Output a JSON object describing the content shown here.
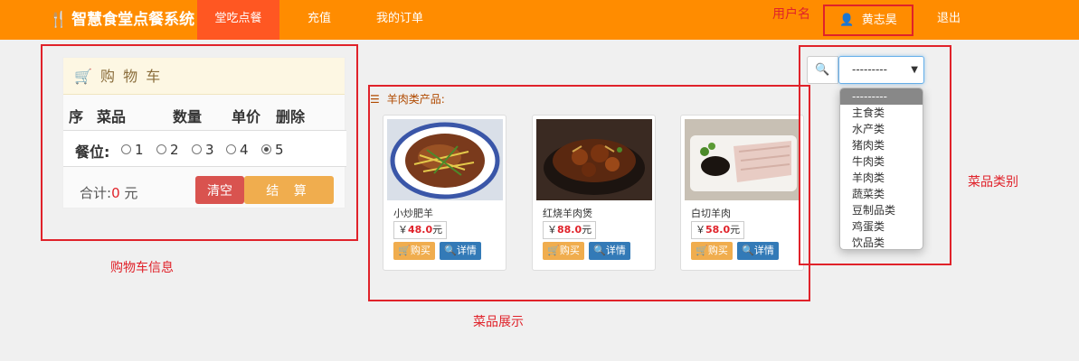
{
  "nav": {
    "brand": "智慧食堂点餐系统",
    "items": [
      "堂吃点餐",
      "充值",
      "我的订单"
    ],
    "user_name": "黄志昊",
    "logout": "退出"
  },
  "annotations": {
    "username": "用户名",
    "cart_info": "购物车信息",
    "dish_display": "菜品展示",
    "dish_category": "菜品类别"
  },
  "cart": {
    "title": "购 物 车",
    "columns": [
      "序",
      "菜品",
      "数量",
      "单价",
      "删除"
    ],
    "seat_label": "餐位:",
    "seats": [
      "1",
      "2",
      "3",
      "4",
      "5"
    ],
    "selected_seat": "5",
    "total_label": "合计:",
    "total_amount": "0",
    "total_unit": " 元",
    "clear": "清空",
    "checkout": "结 算"
  },
  "products": {
    "category_label": "羊肉类产品:",
    "items": [
      {
        "name": "小炒肥羊",
        "currency": "￥",
        "price": "48.0",
        "unit": "元",
        "buy": "购买",
        "detail": "详情"
      },
      {
        "name": "红烧羊肉煲",
        "currency": "￥",
        "price": "88.0",
        "unit": "元",
        "buy": "购买",
        "detail": "详情"
      },
      {
        "name": "白切羊肉",
        "currency": "￥",
        "price": "58.0",
        "unit": "元",
        "buy": "购买",
        "detail": "详情"
      }
    ]
  },
  "category_select": {
    "value": "---------",
    "options": [
      "---------",
      "主食类",
      "水产类",
      "猪肉类",
      "牛肉类",
      "羊肉类",
      "蔬菜类",
      "豆制品类",
      "鸡蛋类",
      "饮品类"
    ]
  },
  "colors": {
    "navbar": "#ff8c00",
    "active_nav": "#ff5722",
    "annotation_red": "#e0222a",
    "clear_button": "#d9534f",
    "checkout_button": "#f0ad4e",
    "detail_button": "#337ab7"
  }
}
